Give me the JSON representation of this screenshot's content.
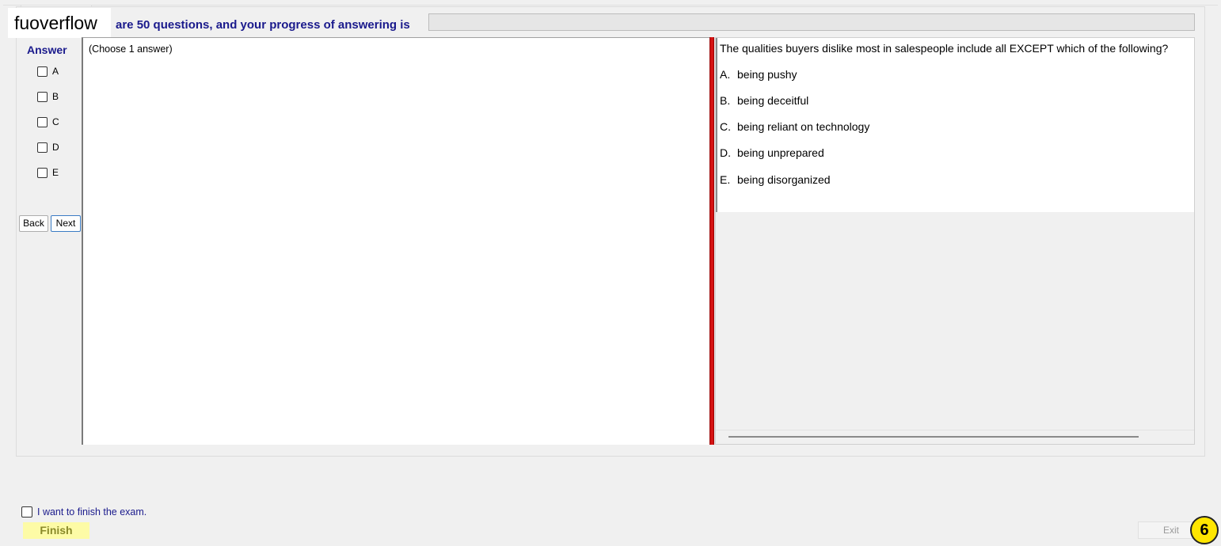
{
  "brand": {
    "logo_text": "fuoverflow"
  },
  "header": {
    "progress_text": "are 50 questions, and your progress of answering is",
    "progress": {
      "value": 0
    }
  },
  "answer_panel": {
    "heading": "Answer",
    "choices": [
      "A",
      "B",
      "C",
      "D",
      "E"
    ],
    "back_label": "Back",
    "next_label": "Next"
  },
  "left_pane": {
    "hint": "(Choose 1 answer)"
  },
  "question": {
    "text": "The qualities buyers dislike most in salespeople include all EXCEPT which of the following?",
    "options": [
      {
        "letter": "A.",
        "text": "being pushy"
      },
      {
        "letter": "B.",
        "text": "being deceitful"
      },
      {
        "letter": "C.",
        "text": "being reliant on technology"
      },
      {
        "letter": "D.",
        "text": "being unprepared"
      },
      {
        "letter": "E.",
        "text": "being disorganized"
      }
    ]
  },
  "footer": {
    "finish_check_label": "I want to finish the exam.",
    "finish_label": "Finish",
    "exit_label": "Exit",
    "badge": "6"
  },
  "colors": {
    "label_blue": "#1a1a8c",
    "splitter_red": "#d51212",
    "finish_yellow": "#fdfba6",
    "badge_yellow": "#ffe600"
  }
}
